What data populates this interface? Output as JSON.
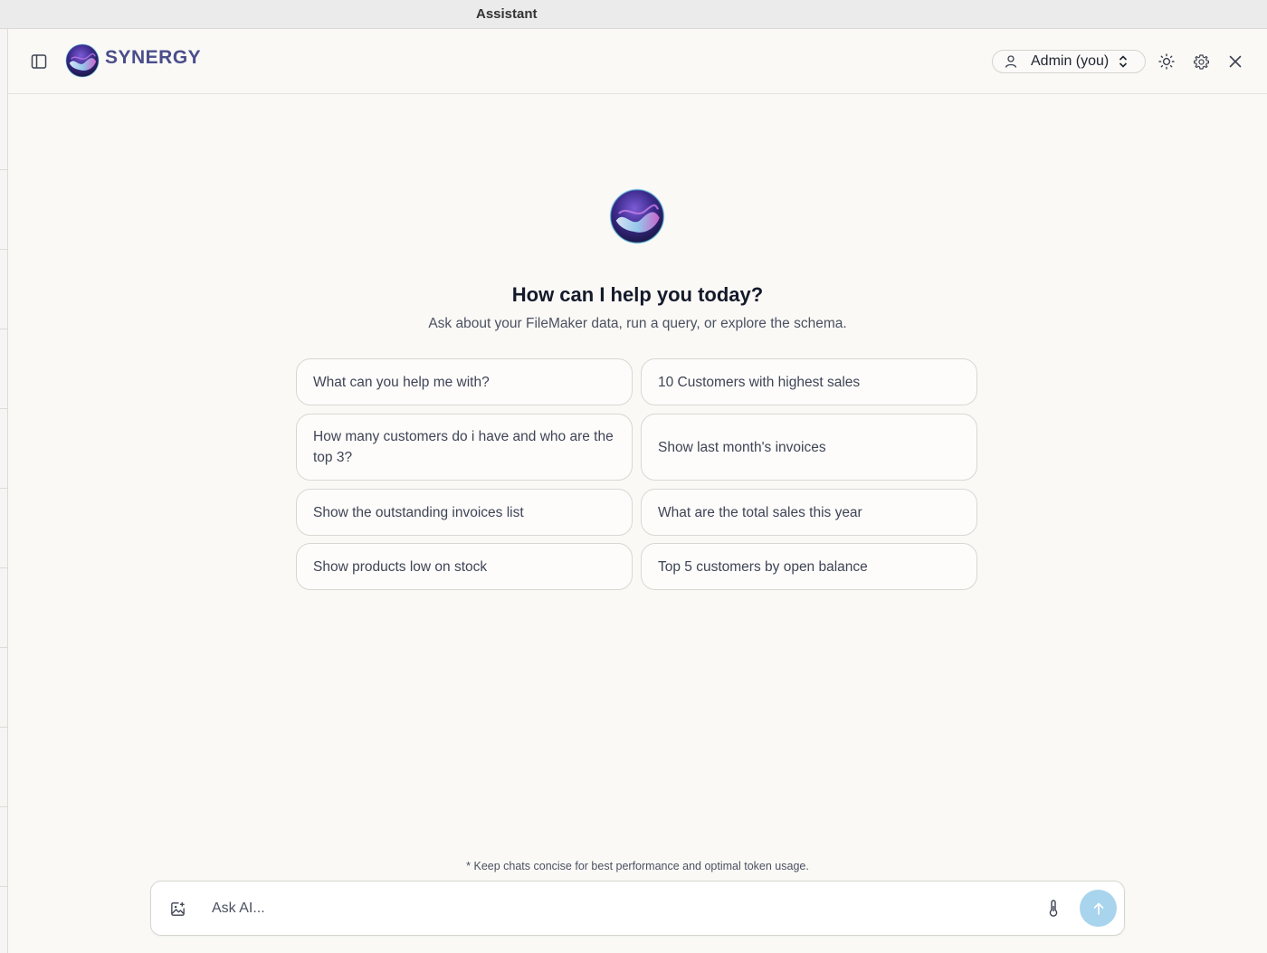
{
  "window": {
    "title": "Assistant"
  },
  "header": {
    "brand": "SYNERGY",
    "user_select": {
      "value": "Admin (you)"
    }
  },
  "welcome": {
    "headline": "How can I help you today?",
    "subline": "Ask about your FileMaker data, run a query, or explore the schema."
  },
  "suggestions": [
    "What can you help me with?",
    "10 Customers with highest sales",
    "How many customers do i have and who are the top 3?",
    "Show last month's invoices",
    "Show the outstanding invoices list",
    "What are the total sales this year",
    "Show products low on stock",
    "Top 5 customers by open balance"
  ],
  "footer_note": "* Keep chats concise for best performance and optimal token usage.",
  "composer": {
    "placeholder": "Ask AI..."
  },
  "icons": {
    "sidebar_toggle": "sidebar-icon",
    "user": "person-icon",
    "select": "chevron-updown-icon",
    "theme": "sun-icon",
    "settings": "gear-icon",
    "close": "close-icon",
    "attach": "image-add-icon",
    "temperature": "thermometer-icon",
    "send": "arrow-up-icon"
  },
  "colors": {
    "brand": "#4a4e8a",
    "send_button": "#a9d4ee",
    "background": "#faf9f6"
  }
}
